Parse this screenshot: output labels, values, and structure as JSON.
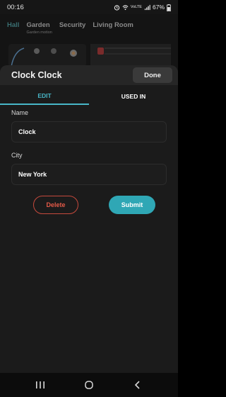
{
  "status_bar": {
    "time": "00:16",
    "battery": "67%",
    "network": "VoLTE"
  },
  "background_app": {
    "tabs": [
      {
        "label": "Hall",
        "sublabel": ""
      },
      {
        "label": "Garden",
        "sublabel": "Garden motion"
      },
      {
        "label": "Security",
        "sublabel": ""
      },
      {
        "label": "Living Room",
        "sublabel": ""
      }
    ]
  },
  "sheet": {
    "title": "Clock Clock",
    "done_label": "Done",
    "tabs": [
      {
        "label": "EDIT",
        "active": true
      },
      {
        "label": "USED IN",
        "active": false
      }
    ],
    "fields": {
      "name_label": "Name",
      "name_value": "Clock",
      "city_label": "City",
      "city_value": "New York"
    },
    "delete_label": "Delete",
    "submit_label": "Submit"
  },
  "colors": {
    "accent": "#48b6c7",
    "submit": "#2fa7b5",
    "delete": "#e55a48"
  },
  "nav_icons": [
    "recent-apps-icon",
    "home-icon",
    "back-icon"
  ]
}
